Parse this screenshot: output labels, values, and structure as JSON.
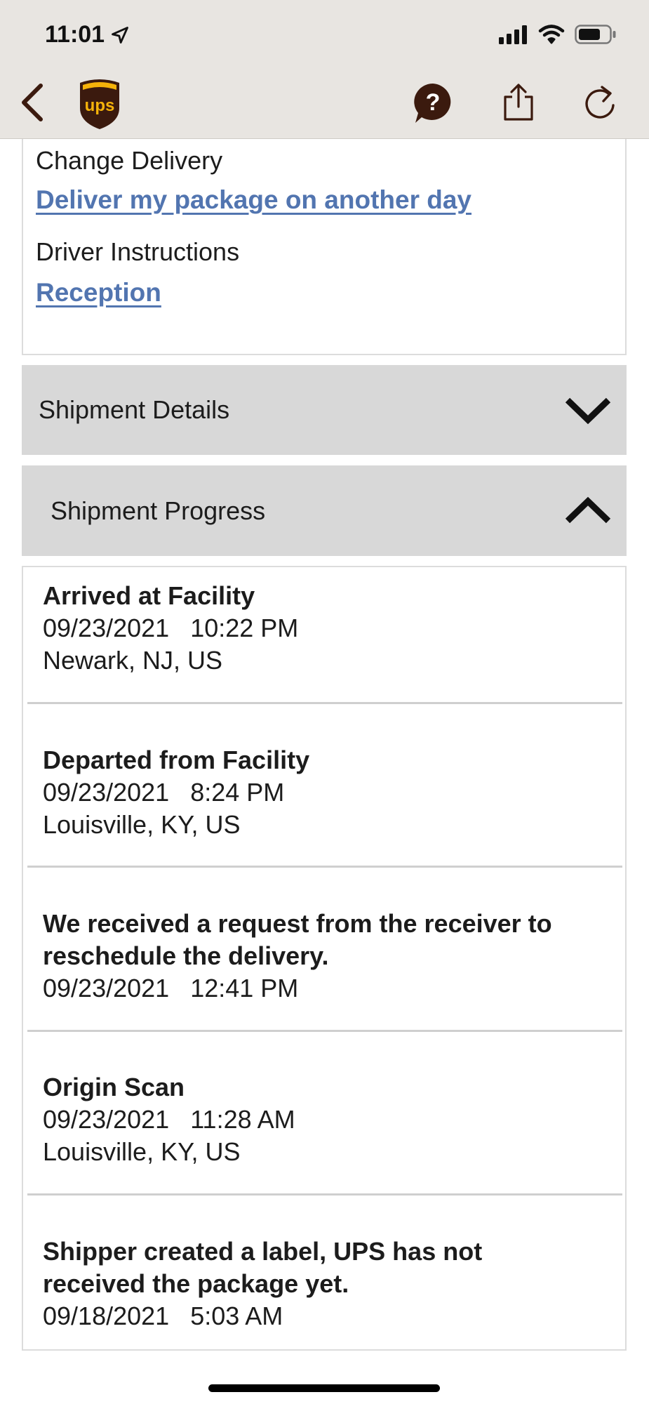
{
  "status_bar": {
    "time": "11:01"
  },
  "nav": {
    "back_icon": "chevron-left-icon",
    "logo": "ups-logo",
    "help_icon": "help-bubble-icon",
    "share_icon": "share-icon",
    "refresh_icon": "refresh-icon",
    "brand_brown": "#3b1a0e",
    "brand_gold": "#f6b30a"
  },
  "delivery": {
    "change_delivery_label": "Change Delivery",
    "change_delivery_link": "Deliver my package on another day",
    "driver_instructions_label": "Driver Instructions",
    "driver_instructions_link": "Reception",
    "link_color": "#5275b0"
  },
  "sections": {
    "shipment_details": "Shipment Details",
    "shipment_progress": "Shipment Progress"
  },
  "progress": [
    {
      "title": "Arrived at Facility",
      "date": "09/23/2021",
      "time": "10:22 PM",
      "location": "Newark, NJ, US"
    },
    {
      "title": "Departed from Facility",
      "date": "09/23/2021",
      "time": "8:24 PM",
      "location": "Louisville, KY, US"
    },
    {
      "title": "We received a request from the receiver to",
      "title2": "reschedule the delivery.",
      "date": "09/23/2021",
      "time": "12:41 PM"
    },
    {
      "title": "Origin Scan",
      "date": "09/23/2021",
      "time": "11:28 AM",
      "location": "Louisville, KY, US"
    },
    {
      "title": "Shipper created a label, UPS has not",
      "title2": "received the package yet.",
      "date": "09/18/2021",
      "time": "5:03 AM"
    }
  ]
}
